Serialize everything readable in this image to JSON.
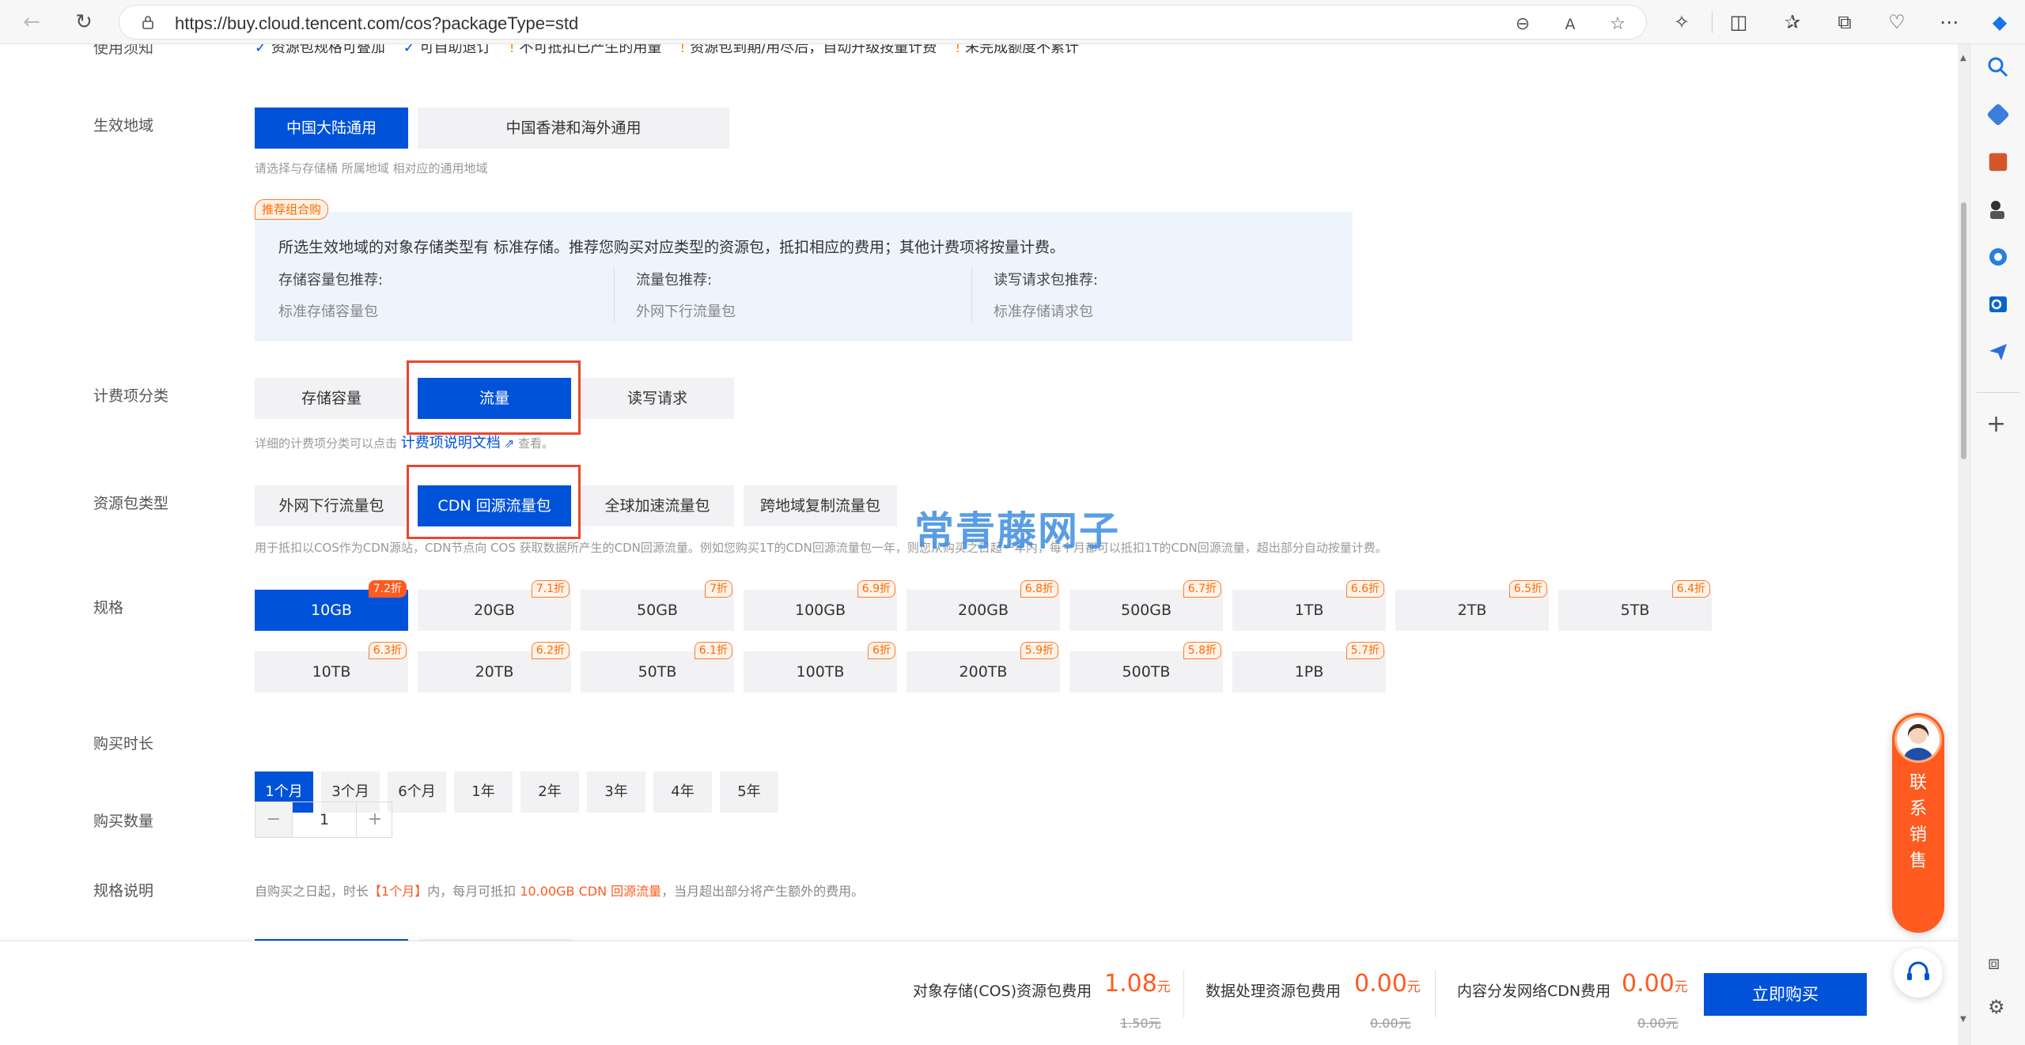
{
  "browser": {
    "url": "https://buy.cloud.tencent.com/cos?packageType=std"
  },
  "top_notice": {
    "label": "使用须知",
    "items": [
      "资源包规格可叠加",
      "可自助退订",
      "不可抵扣已产生的用量",
      "资源包到期/用尽后，自动升级按量计费",
      "未完成额度不累计"
    ]
  },
  "region": {
    "label": "生效地域",
    "options": [
      "中国大陆通用",
      "中国香港和海外通用"
    ],
    "selected": "中国大陆通用",
    "hint": "请选择与存储桶 所属地域 相对应的通用地域"
  },
  "recommendation": {
    "tag": "推荐组合购",
    "text": "所选生效地域的对象存储类型有 标准存储。推荐您购买对应类型的资源包，抵扣相应的费用；其他计费项将按量计费。",
    "columns": [
      {
        "title": "存储容量包推荐:",
        "value": "标准存储容量包"
      },
      {
        "title": "流量包推荐:",
        "value": "外网下行流量包"
      },
      {
        "title": "读写请求包推荐:",
        "value": "标准存储请求包"
      }
    ]
  },
  "billing_category": {
    "label": "计费项分类",
    "options": [
      "存储容量",
      "流量",
      "读写请求"
    ],
    "selected": "流量",
    "hint_prefix": "详细的计费项分类可以点击",
    "hint_link": "计费项说明文档",
    "hint_suffix": "查看。"
  },
  "package_type": {
    "label": "资源包类型",
    "options": [
      "外网下行流量包",
      "CDN 回源流量包",
      "全球加速流量包",
      "跨地域复制流量包"
    ],
    "selected": "CDN 回源流量包",
    "hint": "用于抵扣以COS作为CDN源站，CDN节点向 COS 获取数据所产生的CDN回源流量。例如您购买1T的CDN回源流量包一年，则您从购买之日起一年内，每个月都可以抵扣1T的CDN回源流量，超出部分自动按量计费。"
  },
  "spec": {
    "label": "规格",
    "row1": [
      {
        "size": "10GB",
        "discount": "7.2折"
      },
      {
        "size": "20GB",
        "discount": "7.1折"
      },
      {
        "size": "50GB",
        "discount": "7折"
      },
      {
        "size": "100GB",
        "discount": "6.9折"
      },
      {
        "size": "200GB",
        "discount": "6.8折"
      },
      {
        "size": "500GB",
        "discount": "6.7折"
      },
      {
        "size": "1TB",
        "discount": "6.6折"
      },
      {
        "size": "2TB",
        "discount": "6.5折"
      },
      {
        "size": "5TB",
        "discount": "6.4折"
      }
    ],
    "row2": [
      {
        "size": "10TB",
        "discount": "6.3折"
      },
      {
        "size": "20TB",
        "discount": "6.2折"
      },
      {
        "size": "50TB",
        "discount": "6.1折"
      },
      {
        "size": "100TB",
        "discount": "6折"
      },
      {
        "size": "200TB",
        "discount": "5.9折"
      },
      {
        "size": "500TB",
        "discount": "5.8折"
      },
      {
        "size": "1PB",
        "discount": "5.7折"
      }
    ],
    "selected": "10GB"
  },
  "duration": {
    "label": "购买时长",
    "options": [
      "1个月",
      "3个月",
      "6个月",
      "1年",
      "2年",
      "3年",
      "4年",
      "5年"
    ],
    "selected": "1个月"
  },
  "quantity": {
    "label": "购买数量",
    "minus": "−",
    "value": "1",
    "plus": "+"
  },
  "spec_desc": {
    "label": "规格说明",
    "prefix": "自购买之日起，时长",
    "duration": "【1个月】",
    "middle": "内，每月可抵扣",
    "amount": "10.00GB CDN 回源流量",
    "suffix": "，当月超出部分将产生额外的费用。"
  },
  "watermark": "常青藤网子",
  "footer": {
    "fees": [
      {
        "label": "对象存储(COS)资源包费用",
        "value": "1.08",
        "unit": "元",
        "original": "1.50元"
      },
      {
        "label": "数据处理资源包费用",
        "value": "0.00",
        "unit": "元",
        "original": "0.00元"
      },
      {
        "label": "内容分发网络CDN费用",
        "value": "0.00",
        "unit": "元",
        "original": "0.00元"
      }
    ],
    "buy_label": "立即购买"
  },
  "contact": {
    "chars": [
      "联",
      "系",
      "销",
      "售"
    ]
  },
  "colors": {
    "primary": "#0052d9",
    "accent": "#ff5a1f",
    "highlight_box": "#e8472e"
  }
}
